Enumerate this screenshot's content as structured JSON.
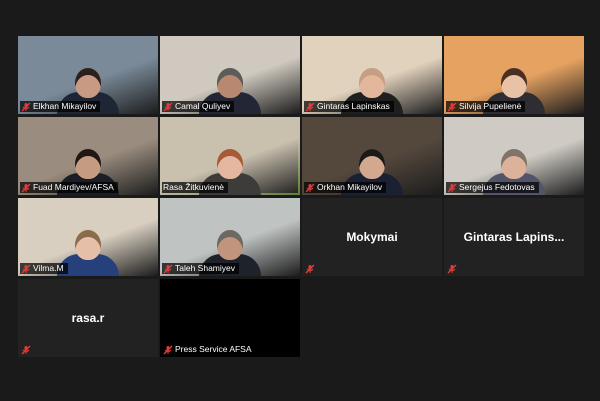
{
  "participants": [
    {
      "name": "Elkhan Mikayilov",
      "muted": true,
      "video": true,
      "bg": "#7a8a99",
      "skin": "#c89a84",
      "hair": "#2a211c",
      "shirt": "#1e2535"
    },
    {
      "name": "Camal Quliyev",
      "muted": true,
      "video": true,
      "bg": "#cfc9bf",
      "skin": "#b88970",
      "hair": "#5c5c5c",
      "shirt": "#232634"
    },
    {
      "name": "Gintaras Lapinskas",
      "muted": true,
      "video": true,
      "bg": "#e1d2bd",
      "skin": "#e2b79c",
      "hair": "#c49f83",
      "shirt": "#1f1f1f"
    },
    {
      "name": "Silvija Pupelienė",
      "muted": true,
      "video": true,
      "bg": "#e6a261",
      "skin": "#e9c1a5",
      "hair": "#4a3022",
      "shirt": "#2d2d33"
    },
    {
      "name": "Fuad Mardiyev/AFSA",
      "muted": true,
      "video": true,
      "bg": "#9a8c7e",
      "skin": "#c49c82",
      "hair": "#1f1814",
      "shirt": "#1b1e26"
    },
    {
      "name": "Rasa Žitkuvienė",
      "muted": false,
      "video": true,
      "active": true,
      "bg": "#c9c0ae",
      "skin": "#e5b7a1",
      "hair": "#a65a37",
      "shirt": "#3d3c3a"
    },
    {
      "name": "Orkhan Mikayilov",
      "muted": true,
      "video": true,
      "bg": "#54483d",
      "skin": "#d2a88f",
      "hair": "#1c1a19",
      "shirt": "#1a2133"
    },
    {
      "name": "Sergejus Fedotovas",
      "muted": true,
      "video": true,
      "bg": "#cfcbc4",
      "skin": "#ddb29b",
      "hair": "#80746a",
      "shirt": "#52546a"
    },
    {
      "name": "Vilma.M",
      "muted": true,
      "video": true,
      "bg": "#d8cfc1",
      "skin": "#e6bfa9",
      "hair": "#8a6b4b",
      "shirt": "#25407a"
    },
    {
      "name": "Taleh Shamiyev",
      "muted": true,
      "video": true,
      "bg": "#bfc3c2",
      "skin": "#c1947d",
      "hair": "#6c6863",
      "shirt": "#1e232b"
    },
    {
      "name": "Mokymai",
      "muted": true,
      "video": false
    },
    {
      "name": "Gintaras Lapins...",
      "muted": true,
      "video": false
    },
    {
      "name": "rasa.r",
      "muted": true,
      "video": false
    },
    {
      "name": "Press Service AFSA",
      "muted": true,
      "video": true,
      "blank": true
    }
  ],
  "colors": {
    "mute_icon": "#e23b3b",
    "active_border": "#8bc34a",
    "background": "#1a1a1a"
  },
  "icons": {
    "muted": "microphone-muted-icon"
  }
}
